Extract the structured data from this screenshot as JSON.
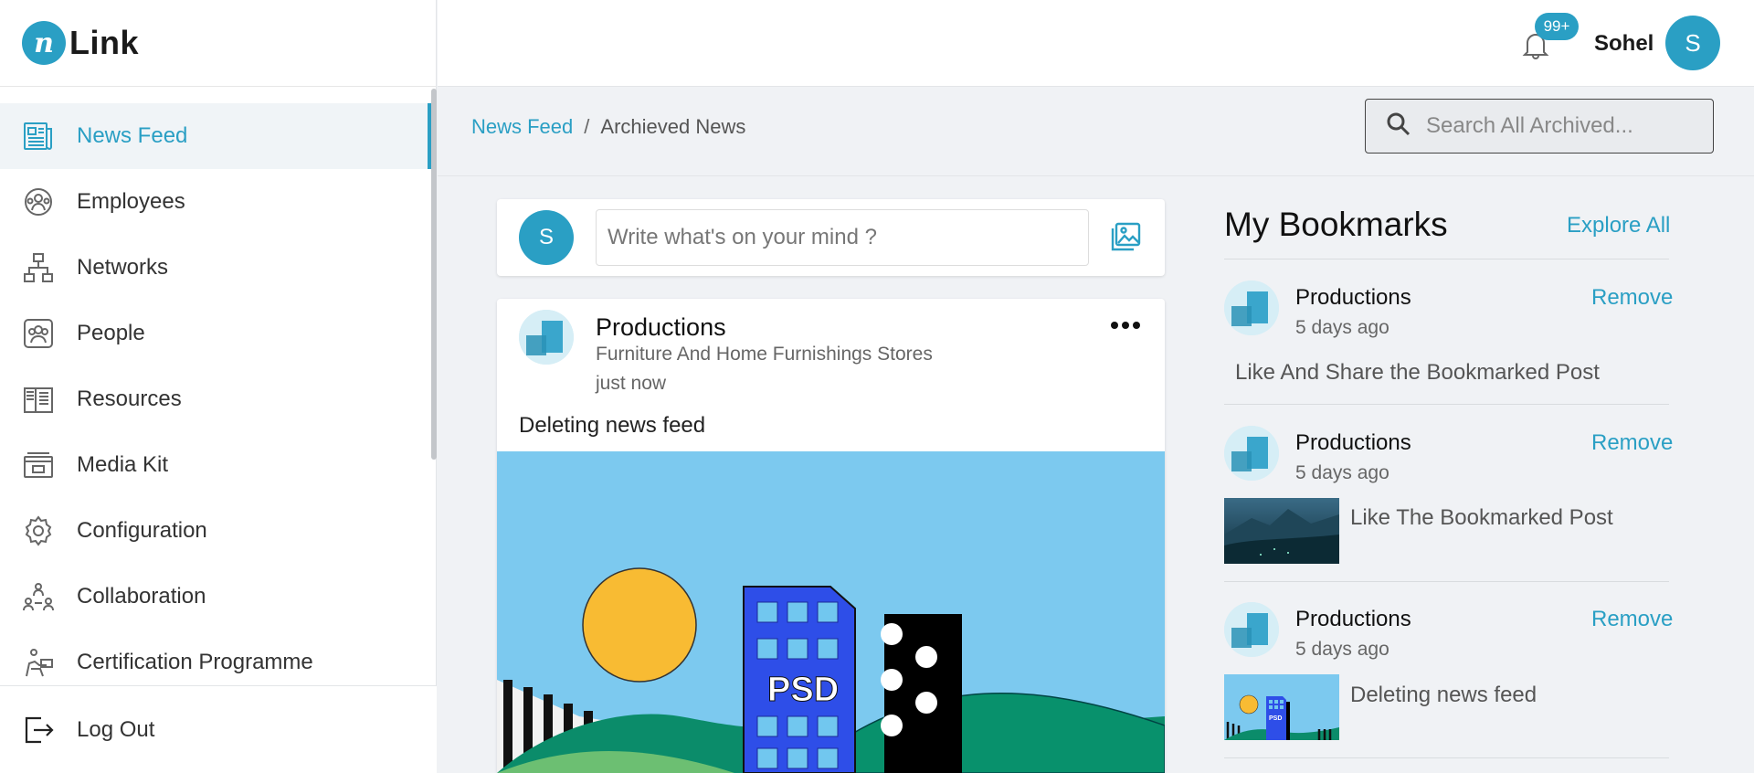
{
  "app": {
    "logo_text": "Link",
    "logo_mark": "n"
  },
  "sidebar": {
    "items": [
      {
        "label": "News Feed",
        "icon": "newspaper-icon",
        "active": true
      },
      {
        "label": "Employees",
        "icon": "employees-icon"
      },
      {
        "label": "Networks",
        "icon": "network-icon"
      },
      {
        "label": "People",
        "icon": "people-icon"
      },
      {
        "label": "Resources",
        "icon": "book-icon"
      },
      {
        "label": "Media Kit",
        "icon": "media-kit-icon"
      },
      {
        "label": "Configuration",
        "icon": "gear-icon"
      },
      {
        "label": "Collaboration",
        "icon": "collaboration-icon"
      },
      {
        "label": "Certification Programme",
        "icon": "certification-icon"
      }
    ],
    "logout_label": "Log Out"
  },
  "topbar": {
    "notification_count": "99+",
    "user_name": "Sohel",
    "user_initial": "S"
  },
  "breadcrumb": {
    "parent": "News Feed",
    "separator": "/",
    "current": "Archieved News"
  },
  "search": {
    "placeholder": "Search All Archived..."
  },
  "composer": {
    "avatar_initial": "S",
    "placeholder": "Write what's on your mind ?"
  },
  "post": {
    "author": "Productions",
    "subtitle": "Furniture And Home Furnishings Stores",
    "time": "just now",
    "text": "Deleting news feed",
    "image_label": "PSD"
  },
  "bookmarks": {
    "title": "My Bookmarks",
    "explore_label": "Explore All",
    "items": [
      {
        "author": "Productions",
        "time": "5 days ago",
        "remove_label": "Remove",
        "text": "Like And Share the Bookmarked Post"
      },
      {
        "author": "Productions",
        "time": "5 days ago",
        "remove_label": "Remove",
        "text": "Like The Bookmarked Post"
      },
      {
        "author": "Productions",
        "time": "5 days ago",
        "remove_label": "Remove",
        "text": "Deleting news feed"
      }
    ]
  },
  "colors": {
    "accent": "#2a9fc4",
    "background": "#f0f2f5",
    "sidebar_active": "#f0f4f7"
  }
}
